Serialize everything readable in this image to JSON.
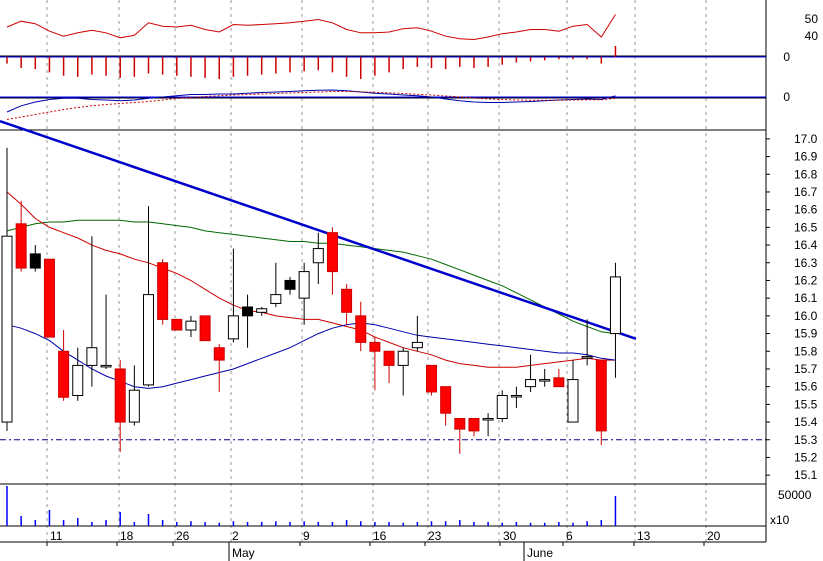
{
  "chart_data": {
    "type": "candlestick",
    "colors": {
      "up_body": "#ffffff",
      "down_body": "#ff0000",
      "black_body": "#000000",
      "frame": "#000000",
      "grid": "#999999",
      "trendline": "#0000cc",
      "ma_fast": "#cc0000",
      "ma_slow": "#0000aa",
      "ma_long": "#006600",
      "support": "#000088",
      "rsi": "#cc0000",
      "volume": "#0000ff"
    },
    "x_ticks": [
      "11",
      "18",
      "26",
      "2",
      "9",
      "16",
      "23",
      "30",
      "6",
      "13",
      "20"
    ],
    "month_labels": [
      "May",
      "June"
    ],
    "price_axis": {
      "ticks": [
        "15.1",
        "15.2",
        "15.3",
        "15.4",
        "15.5",
        "15.6",
        "15.7",
        "15.8",
        "15.9",
        "16.0",
        "16.1",
        "16.2",
        "16.3",
        "16.4",
        "16.5",
        "16.6",
        "16.7",
        "16.8",
        "16.9",
        "17.0"
      ],
      "ylim": [
        15.05,
        17.05
      ],
      "support_level": 15.3
    },
    "rsi_axis": {
      "ticks": [
        "50",
        "40"
      ]
    },
    "macd_hist_axis": {
      "ticks": [
        "0"
      ]
    },
    "macd_axis": {
      "ticks": [
        "0"
      ]
    },
    "volume_axis": {
      "ticks": [
        "50000"
      ],
      "multiplier": "x10"
    },
    "candles": [
      {
        "d": "Apr 7",
        "o": 15.4,
        "h": 16.95,
        "l": 15.35,
        "c": 16.45,
        "k": "up"
      },
      {
        "d": "Apr 8",
        "o": 16.52,
        "h": 16.65,
        "l": 16.25,
        "c": 16.27,
        "k": "down"
      },
      {
        "d": "Apr 9",
        "o": 16.35,
        "h": 16.4,
        "l": 16.25,
        "c": 16.27,
        "k": "black"
      },
      {
        "d": "Apr 10",
        "o": 16.32,
        "h": 16.32,
        "l": 15.88,
        "c": 15.88,
        "k": "down"
      },
      {
        "d": "Apr 11",
        "o": 15.8,
        "h": 15.92,
        "l": 15.52,
        "c": 15.54,
        "k": "down"
      },
      {
        "d": "Apr 14",
        "o": 15.55,
        "h": 15.82,
        "l": 15.52,
        "c": 15.72,
        "k": "up"
      },
      {
        "d": "Apr 15",
        "o": 15.72,
        "h": 16.45,
        "l": 15.6,
        "c": 15.82,
        "k": "up"
      },
      {
        "d": "Apr 16",
        "o": 15.72,
        "h": 16.12,
        "l": 15.7,
        "c": 15.72,
        "k": "up"
      },
      {
        "d": "Apr 17",
        "o": 15.7,
        "h": 15.75,
        "l": 15.23,
        "c": 15.4,
        "k": "down"
      },
      {
        "d": "Apr 18",
        "o": 15.4,
        "h": 15.72,
        "l": 15.38,
        "c": 15.58,
        "k": "up"
      },
      {
        "d": "Apr 21",
        "o": 15.61,
        "h": 16.62,
        "l": 15.6,
        "c": 16.12,
        "k": "up"
      },
      {
        "d": "Apr 22",
        "o": 16.3,
        "h": 16.32,
        "l": 15.95,
        "c": 15.98,
        "k": "down"
      },
      {
        "d": "Apr 23",
        "o": 15.98,
        "h": 15.98,
        "l": 15.92,
        "c": 15.92,
        "k": "down"
      },
      {
        "d": "Apr 24",
        "o": 15.92,
        "h": 16.0,
        "l": 15.88,
        "c": 15.97,
        "k": "up"
      },
      {
        "d": "Apr 25",
        "o": 16.0,
        "h": 16.0,
        "l": 15.86,
        "c": 15.86,
        "k": "down"
      },
      {
        "d": "Apr 28",
        "o": 15.82,
        "h": 15.84,
        "l": 15.57,
        "c": 15.75,
        "k": "down"
      },
      {
        "d": "Apr 29",
        "o": 15.87,
        "h": 16.38,
        "l": 15.85,
        "c": 16.0,
        "k": "up"
      },
      {
        "d": "Apr 30",
        "o": 16.05,
        "h": 16.12,
        "l": 15.82,
        "c": 16.0,
        "k": "black"
      },
      {
        "d": "May 1",
        "o": 16.02,
        "h": 16.05,
        "l": 16.0,
        "c": 16.04,
        "k": "up"
      },
      {
        "d": "May 2",
        "o": 16.07,
        "h": 16.3,
        "l": 16.05,
        "c": 16.12,
        "k": "up"
      },
      {
        "d": "May 5",
        "o": 16.2,
        "h": 16.22,
        "l": 16.12,
        "c": 16.15,
        "k": "black"
      },
      {
        "d": "May 6",
        "o": 16.1,
        "h": 16.3,
        "l": 15.95,
        "c": 16.25,
        "k": "up"
      },
      {
        "d": "May 7",
        "o": 16.3,
        "h": 16.47,
        "l": 16.18,
        "c": 16.38,
        "k": "up"
      },
      {
        "d": "May 8",
        "o": 16.47,
        "h": 16.5,
        "l": 16.12,
        "c": 16.25,
        "k": "down"
      },
      {
        "d": "May 9",
        "o": 16.15,
        "h": 16.18,
        "l": 15.95,
        "c": 16.02,
        "k": "down"
      },
      {
        "d": "May 12",
        "o": 16.0,
        "h": 16.08,
        "l": 15.8,
        "c": 15.85,
        "k": "down"
      },
      {
        "d": "May 13",
        "o": 15.85,
        "h": 15.88,
        "l": 15.58,
        "c": 15.8,
        "k": "down"
      },
      {
        "d": "May 14",
        "o": 15.8,
        "h": 15.8,
        "l": 15.62,
        "c": 15.72,
        "k": "down"
      },
      {
        "d": "May 15",
        "o": 15.72,
        "h": 15.82,
        "l": 15.55,
        "c": 15.8,
        "k": "up"
      },
      {
        "d": "May 16",
        "o": 15.82,
        "h": 16.0,
        "l": 15.8,
        "c": 15.85,
        "k": "up"
      },
      {
        "d": "May 19",
        "o": 15.72,
        "h": 15.72,
        "l": 15.55,
        "c": 15.57,
        "k": "down"
      },
      {
        "d": "May 20",
        "o": 15.6,
        "h": 15.6,
        "l": 15.38,
        "c": 15.45,
        "k": "down"
      },
      {
        "d": "May 21",
        "o": 15.42,
        "h": 15.42,
        "l": 15.22,
        "c": 15.36,
        "k": "down"
      },
      {
        "d": "May 22",
        "o": 15.42,
        "h": 15.42,
        "l": 15.32,
        "c": 15.35,
        "k": "down"
      },
      {
        "d": "May 23",
        "o": 15.42,
        "h": 15.45,
        "l": 15.32,
        "c": 15.42,
        "k": "up"
      },
      {
        "d": "May 27",
        "o": 15.42,
        "h": 15.58,
        "l": 15.4,
        "c": 15.55,
        "k": "up"
      },
      {
        "d": "May 28",
        "o": 15.55,
        "h": 15.6,
        "l": 15.48,
        "c": 15.55,
        "k": "up"
      },
      {
        "d": "May 29",
        "o": 15.6,
        "h": 15.78,
        "l": 15.57,
        "c": 15.64,
        "k": "up"
      },
      {
        "d": "May 30",
        "o": 15.64,
        "h": 15.7,
        "l": 15.6,
        "c": 15.64,
        "k": "up"
      },
      {
        "d": "Jun 2",
        "o": 15.65,
        "h": 15.7,
        "l": 15.6,
        "c": 15.6,
        "k": "down"
      },
      {
        "d": "Jun 3",
        "o": 15.4,
        "h": 15.75,
        "l": 15.4,
        "c": 15.64,
        "k": "up"
      },
      {
        "d": "Jun 4",
        "o": 15.77,
        "h": 15.98,
        "l": 15.72,
        "c": 15.77,
        "k": "up"
      },
      {
        "d": "Jun 5",
        "o": 15.75,
        "h": 15.75,
        "l": 15.27,
        "c": 15.35,
        "k": "down"
      },
      {
        "d": "Jun 6",
        "o": 15.9,
        "h": 16.3,
        "l": 15.65,
        "c": 16.22,
        "k": "up"
      }
    ],
    "trendline": [
      {
        "d": "Apr 7",
        "y": 17.1
      },
      {
        "d": "Jun 10",
        "y": 15.87
      }
    ],
    "ma_fast": [
      16.7,
      16.63,
      16.55,
      16.5,
      16.47,
      16.44,
      16.4,
      16.37,
      16.35,
      16.32,
      16.3,
      16.27,
      16.24,
      16.2,
      16.15,
      16.1,
      16.06,
      16.03,
      16.02,
      16.0,
      15.99,
      15.98,
      15.98,
      15.96,
      15.94,
      15.92,
      15.88,
      15.85,
      15.82,
      15.8,
      15.78,
      15.75,
      15.73,
      15.72,
      15.71,
      15.71,
      15.71,
      15.72,
      15.73,
      15.74,
      15.75,
      15.76,
      15.75,
      15.75
    ],
    "ma_slow": [
      15.95,
      15.93,
      15.9,
      15.86,
      15.8,
      15.75,
      15.7,
      15.66,
      15.63,
      15.6,
      15.59,
      15.6,
      15.62,
      15.64,
      15.66,
      15.68,
      15.7,
      15.73,
      15.76,
      15.79,
      15.82,
      15.86,
      15.9,
      15.93,
      15.95,
      15.96,
      15.95,
      15.93,
      15.91,
      15.89,
      15.88,
      15.87,
      15.86,
      15.85,
      15.84,
      15.83,
      15.82,
      15.81,
      15.8,
      15.79,
      15.79,
      15.78,
      15.76,
      15.75
    ],
    "ma_long": [
      16.48,
      16.5,
      16.52,
      16.53,
      16.53,
      16.54,
      16.54,
      16.54,
      16.54,
      16.53,
      16.53,
      16.52,
      16.51,
      16.5,
      16.48,
      16.47,
      16.46,
      16.45,
      16.44,
      16.43,
      16.42,
      16.42,
      16.41,
      16.41,
      16.4,
      16.39,
      16.38,
      16.37,
      16.36,
      16.34,
      16.32,
      16.29,
      16.26,
      16.23,
      16.2,
      16.17,
      16.13,
      16.09,
      16.05,
      16.01,
      15.97,
      15.94,
      15.91,
      15.9
    ],
    "rsi": [
      50,
      57,
      54,
      45,
      39,
      43,
      46,
      43,
      37,
      40,
      55,
      51,
      50,
      52,
      47,
      44,
      53,
      52,
      53,
      54,
      55,
      57,
      59,
      55,
      47,
      43,
      43,
      44,
      48,
      49,
      45,
      39,
      36,
      35,
      38,
      42,
      44,
      47,
      47,
      45,
      51,
      53,
      38,
      65
    ],
    "macd_hist": [
      -0.3,
      -0.5,
      -0.55,
      -0.7,
      -0.85,
      -0.9,
      -0.8,
      -0.85,
      -0.95,
      -0.9,
      -0.75,
      -0.8,
      -0.85,
      -0.9,
      -0.95,
      -1.0,
      -0.9,
      -0.85,
      -0.8,
      -0.75,
      -0.7,
      -0.65,
      -0.6,
      -0.7,
      -0.9,
      -1.0,
      -0.85,
      -0.7,
      -0.55,
      -0.45,
      -0.5,
      -0.55,
      -0.45,
      -0.5,
      -0.45,
      -0.35,
      -0.25,
      -0.2,
      -0.15,
      -0.1,
      -0.1,
      -0.1,
      -0.3,
      0.5
    ],
    "macd_line": [
      -0.6,
      -0.35,
      -0.2,
      -0.1,
      -0.05,
      -0.05,
      -0.1,
      -0.12,
      -0.15,
      -0.12,
      -0.05,
      0.0,
      0.05,
      0.1,
      0.1,
      0.12,
      0.12,
      0.15,
      0.18,
      0.2,
      0.22,
      0.25,
      0.27,
      0.28,
      0.25,
      0.2,
      0.15,
      0.12,
      0.08,
      0.05,
      0.0,
      -0.08,
      -0.15,
      -0.2,
      -0.22,
      -0.22,
      -0.2,
      -0.18,
      -0.15,
      -0.12,
      -0.1,
      -0.08,
      -0.1,
      0.05
    ],
    "macd_signal": [
      -0.9,
      -0.8,
      -0.7,
      -0.6,
      -0.5,
      -0.42,
      -0.35,
      -0.3,
      -0.26,
      -0.22,
      -0.18,
      -0.12,
      -0.06,
      -0.02,
      0.02,
      0.05,
      0.08,
      0.1,
      0.12,
      0.14,
      0.16,
      0.18,
      0.2,
      0.22,
      0.22,
      0.21,
      0.19,
      0.17,
      0.14,
      0.11,
      0.08,
      0.04,
      0.0,
      -0.04,
      -0.08,
      -0.1,
      -0.12,
      -0.13,
      -0.13,
      -0.13,
      -0.12,
      -0.11,
      -0.11,
      -0.05
    ],
    "volume": [
      1.0,
      0.25,
      0.15,
      0.4,
      0.15,
      0.2,
      0.1,
      0.15,
      0.35,
      0.1,
      0.3,
      0.15,
      0.1,
      0.12,
      0.1,
      0.08,
      0.12,
      0.1,
      0.1,
      0.12,
      0.1,
      0.12,
      0.1,
      0.1,
      0.15,
      0.12,
      0.1,
      0.1,
      0.08,
      0.1,
      0.12,
      0.12,
      0.15,
      0.1,
      0.1,
      0.08,
      0.1,
      0.08,
      0.08,
      0.1,
      0.08,
      0.12,
      0.15,
      0.75
    ]
  }
}
